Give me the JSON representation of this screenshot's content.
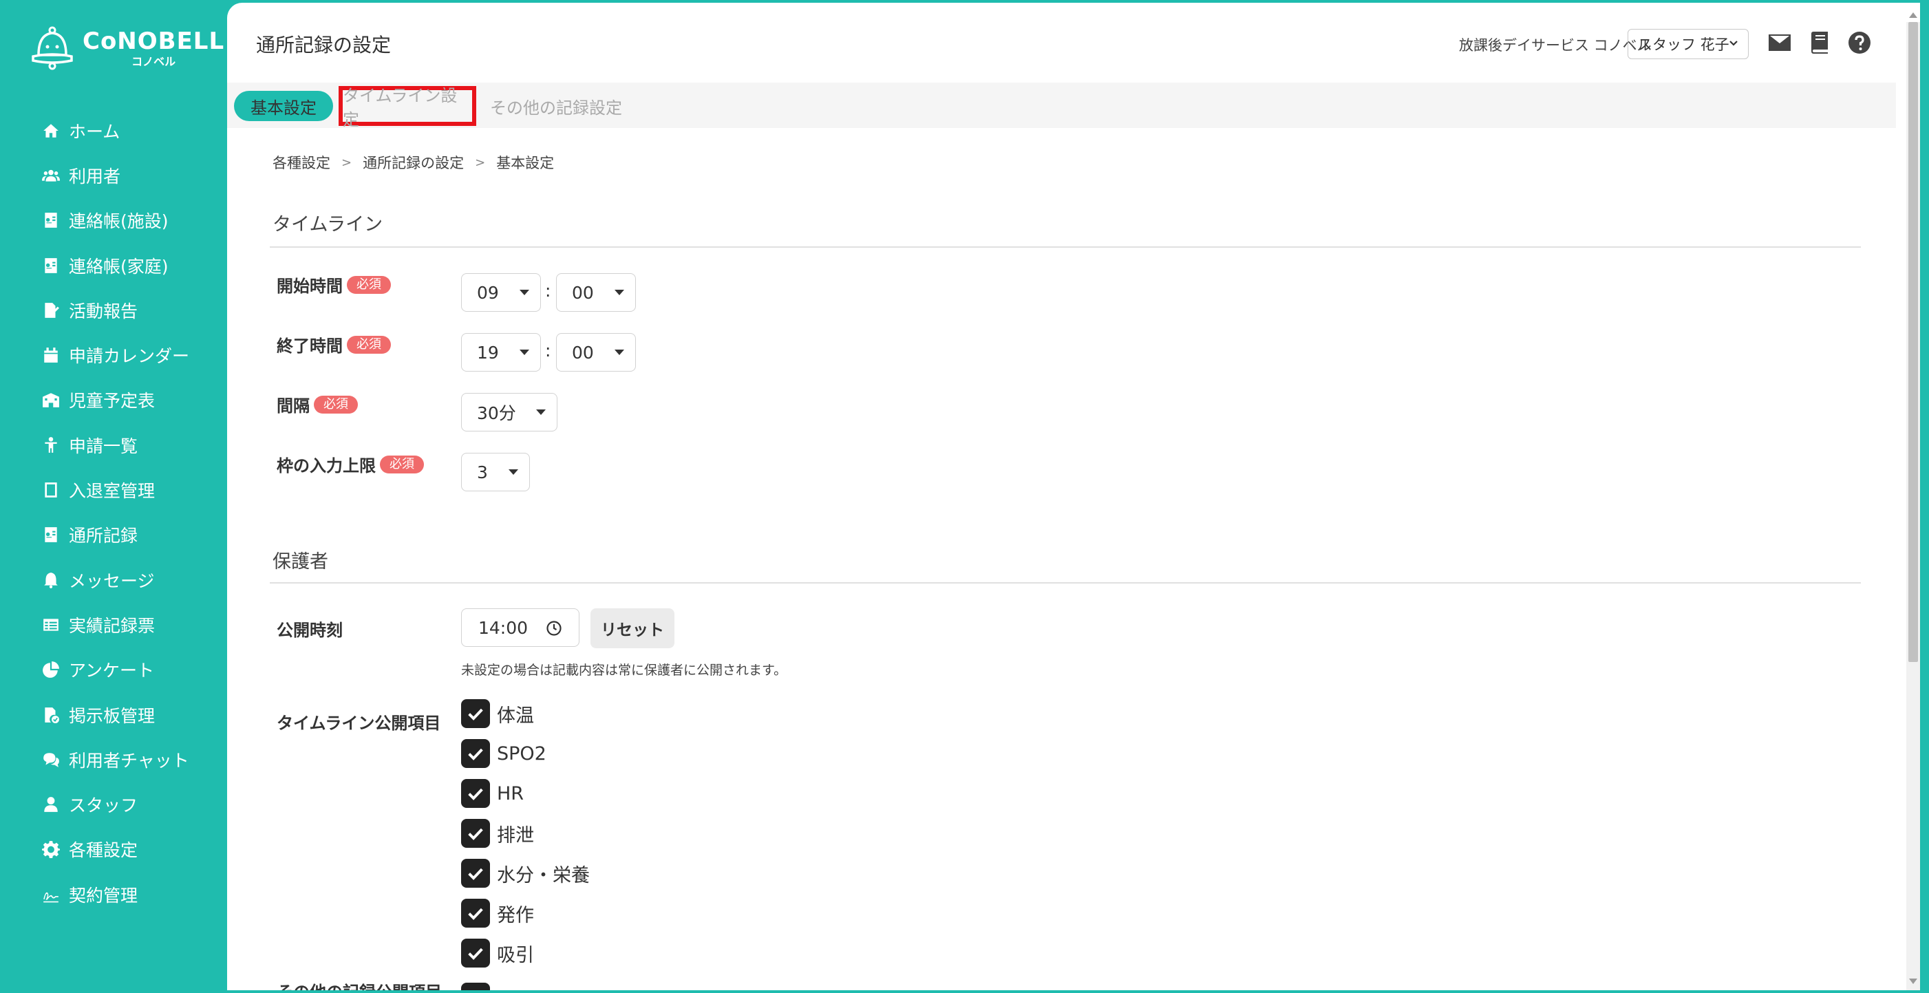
{
  "brand": {
    "name": "CoNOBELL",
    "kana": "コノベル"
  },
  "sidebar": {
    "items": [
      {
        "label": "ホーム",
        "icon": "home-icon"
      },
      {
        "label": "利用者",
        "icon": "users-icon"
      },
      {
        "label": "連絡帳(施設)",
        "icon": "contact-book-icon"
      },
      {
        "label": "連絡帳(家庭)",
        "icon": "contact-book-icon"
      },
      {
        "label": "活動報告",
        "icon": "report-icon"
      },
      {
        "label": "申請カレンダー",
        "icon": "calendar-icon"
      },
      {
        "label": "児童予定表",
        "icon": "building-icon"
      },
      {
        "label": "申請一覧",
        "icon": "child-icon"
      },
      {
        "label": "入退室管理",
        "icon": "tablet-icon"
      },
      {
        "label": "通所記録",
        "icon": "record-icon"
      },
      {
        "label": "メッセージ",
        "icon": "bell-icon"
      },
      {
        "label": "実績記録票",
        "icon": "table-icon"
      },
      {
        "label": "アンケート",
        "icon": "pie-chart-icon"
      },
      {
        "label": "掲示板管理",
        "icon": "board-icon"
      },
      {
        "label": "利用者チャット",
        "icon": "chat-icon"
      },
      {
        "label": "スタッフ",
        "icon": "staff-icon"
      },
      {
        "label": "各種設定",
        "icon": "gear-icon"
      },
      {
        "label": "契約管理",
        "icon": "signature-icon"
      }
    ]
  },
  "header": {
    "title": "通所記録の設定",
    "facility": "放課後デイサービス コノベル",
    "staff": "スタッフ 花子"
  },
  "tabs": {
    "basic": "基本設定",
    "timeline": "タイムライン設定",
    "other": "その他の記録設定"
  },
  "breadcrumb": {
    "a": "各種設定",
    "b": "通所記録の設定",
    "c": "基本設定",
    "sep": ">"
  },
  "timeline": {
    "section": "タイムライン",
    "required": "必須",
    "start_label": "開始時間",
    "start_hour": "09",
    "start_min": "00",
    "end_label": "終了時間",
    "end_hour": "19",
    "end_min": "00",
    "interval_label": "間隔",
    "interval": "30分",
    "limit_label": "枠の入力上限",
    "limit": "3",
    "colon": ":"
  },
  "guardian": {
    "section": "保護者",
    "publish_label": "公開時刻",
    "publish_time": "14:00",
    "reset": "リセット",
    "hint": "未設定の場合は記載内容は常に保護者に公開されます。",
    "items_label": "タイムライン公開項目",
    "items": [
      "体温",
      "SPO2",
      "HR",
      "排泄",
      "水分・栄養",
      "発作",
      "吸引"
    ],
    "other_label": "その他の記録公開項目"
  },
  "colors": {
    "accent": "#1fbcae",
    "required": "#f06b6b",
    "highlight": "#e8141b"
  }
}
